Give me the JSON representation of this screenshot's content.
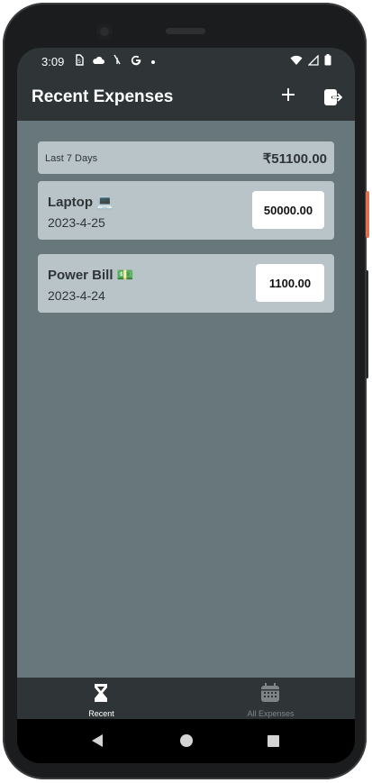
{
  "status_bar": {
    "time": "3:09",
    "left_icons": [
      "sim-icon",
      "cloud-icon",
      "signal-off-icon",
      "google-icon",
      "dot-icon"
    ],
    "right_icons": [
      "wifi-icon",
      "cellular-icon",
      "battery-icon"
    ]
  },
  "app_bar": {
    "title": "Recent Expenses",
    "add_icon": "plus-icon",
    "logout_icon": "logout-icon"
  },
  "summary": {
    "period": "Last 7 Days",
    "total": "₹51100.00"
  },
  "expenses": [
    {
      "name": "Laptop 💻",
      "date": "2023-4-25",
      "amount": "50000.00"
    },
    {
      "name": "Power Bill 💵",
      "date": "2023-4-24",
      "amount": "1100.00"
    }
  ],
  "bottom_nav": {
    "tabs": [
      {
        "label": "Recent",
        "icon": "hourglass-icon",
        "active": true
      },
      {
        "label": "All Expenses",
        "icon": "calendar-icon",
        "active": false
      }
    ]
  },
  "colors": {
    "app_bar": "#2f3536",
    "content_bg": "#68777b",
    "card_bg": "#b8c4c8",
    "active_tab": "#ffffff",
    "inactive_tab": "#7d8587"
  }
}
